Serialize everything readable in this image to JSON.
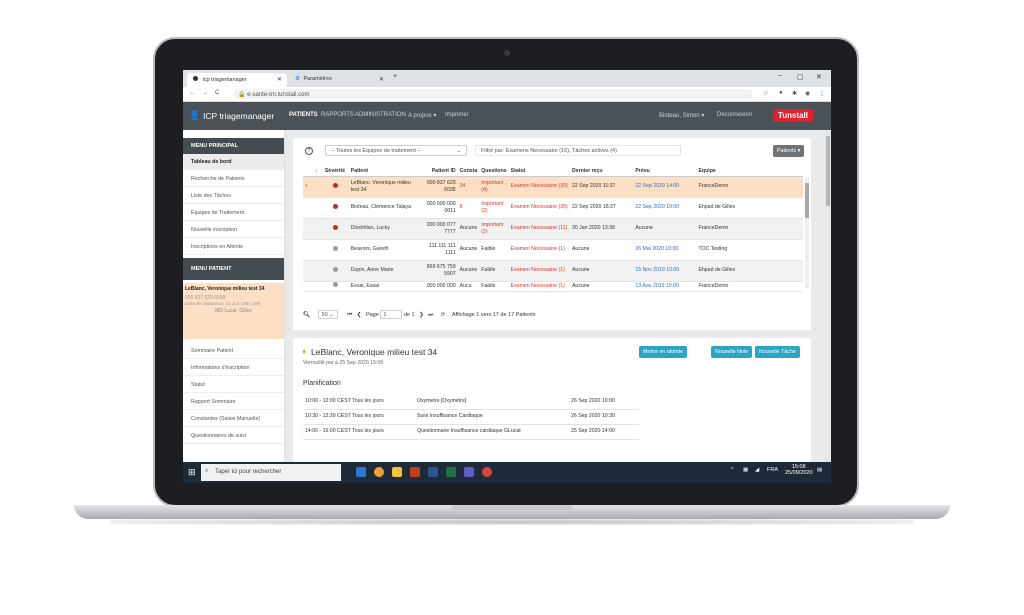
{
  "browser": {
    "tabs": [
      {
        "label": "icp triagemanager"
      },
      {
        "label": "Paramètres"
      }
    ],
    "new_tab": "+",
    "url": "e-sante-tm.tunstall.com",
    "window_controls": [
      "−",
      "▢",
      "✕"
    ]
  },
  "app": {
    "name": "ICP triagemanager",
    "nav": [
      "PATIENTS",
      "RAPPORTS",
      "ADMINISTRATION",
      "A propos ▾",
      "Imprimer"
    ],
    "user": "Bioteau, Simon ▾",
    "logout": "Déconnexion",
    "brand": "Tunstall"
  },
  "sidebar": {
    "menu_principal": "MENU PRINCIPAL",
    "main_items": [
      "Tableau de bord",
      "Recherche de Patients",
      "Liste des Tâches",
      "Equipes de Traitement",
      "Nouvelle inscription",
      "Inscriptions en Attente"
    ],
    "menu_patient": "MENU PATIENT",
    "patient": {
      "name": "LeBlanc, Veronique milieu test 34",
      "id": "000 837 629 6038",
      "dob": "Date de naissance: 21 Jun 1951 (69)",
      "doctor": "MD Lucat, Gilles"
    },
    "patient_items": [
      "Sommaire Patient",
      "Informations d'inscription",
      "Statut",
      "Rapport Sommaire",
      "Constantes (Saisie Manuelle)",
      "Questionnaires de suivi"
    ]
  },
  "filter": {
    "help": "?",
    "teams_select": "-- Toutes les Equipes de traitement --",
    "filter_text": "Filtré par: Examens Necessaire (16), Tâches actives (4)",
    "patients_button": "Patients ▾"
  },
  "table": {
    "headers": [
      "",
      "↓",
      "Sévérité",
      "Patient",
      "Patient ID",
      "Consta",
      "Questions",
      "Statut",
      "Dernier reçu",
      "Prévu",
      "Equipe"
    ],
    "rows": [
      {
        "severity": "red",
        "patient": "LeBlanc, Veronique milieu test 34",
        "id": "000 837 629 6038",
        "consta": "34",
        "questions": "Important (4)",
        "statut": "Examen Necessaire (39)",
        "last": "22 Sep 2020 11:37",
        "planned": "22 Sep 2020 14:00",
        "team": "FranceDemo"
      },
      {
        "severity": "red",
        "patient": "Bioteau, Clémence Talaya",
        "id": "000 000 000 0011",
        "consta": "8",
        "questions": "Important (2)",
        "statut": "Examen Necessaire (30)",
        "last": "22 Sep 2020 18:37",
        "planned": "22 Sep 2020 10:00",
        "team": "Ehpad de Gilles"
      },
      {
        "severity": "red",
        "patient": "Dioclétian, Lucky",
        "id": "000 000 077 7777",
        "consta": "Aucune",
        "questions": "Important (2)",
        "statut": "Examen Necessaire (11)",
        "last": "30 Jan 2020 13:38",
        "planned": "Aucune",
        "team": "FranceDemo"
      },
      {
        "severity": "grey",
        "patient": "Beavors, Gareth",
        "id": "111 111 111 1111",
        "consta": "Aucune",
        "questions": "Faible",
        "statut": "Examen Necessaire (1)",
        "last": "Aucune",
        "planned": "26 Mai 2020 10:00",
        "team": "TOC Testing"
      },
      {
        "severity": "grey",
        "patient": "Dupin, Anne Marie",
        "id": "869 675 759 5907",
        "consta": "Aucune",
        "questions": "Faible",
        "statut": "Examen Necessaire (1)",
        "last": "Aucune",
        "planned": "15 Nov 2019 10:00",
        "team": "Ehpad de Gilles"
      },
      {
        "severity": "grey",
        "patient": "Essai, Essai",
        "id": "000 000 000",
        "consta": "Aucu",
        "questions": "Faible",
        "statut": "Examen Necessaire (1)",
        "last": "Aucune",
        "planned": "13 Aou 2019 10:00",
        "team": "FranceDemo"
      }
    ]
  },
  "pager": {
    "per_page": "50",
    "page_label": "Page",
    "page_value": "1",
    "of": "de 1",
    "summary": "Affichage 1 vers 17 de 17 Patients"
  },
  "detail": {
    "title": "LeBlanc, Veronique milieu test 34",
    "locked": "Verrouillé par à 25 Sep 2020 15:08",
    "buttons": [
      "Mettre en attente",
      "Nouvelle Note",
      "Nouvelle Tâche"
    ],
    "plan_title": "Planification",
    "plan_rows": [
      {
        "time": "10:00 - 12:00 CEST Tous les jours",
        "task": "Oxymetre [Oxymètre]",
        "date": "26 Sep 2020 10:00"
      },
      {
        "time": "10:30 - 12:30 CEST Tous les jours",
        "task": "Suivi Insuffisance Cardiaque",
        "date": "26 Sep 2020 10:30"
      },
      {
        "time": "14:00 - 16:00 CEST Tous les jours",
        "task": "Questionnaire Insuffisance cardiaque GLucat",
        "date": "25 Sep 2020 14:00"
      }
    ]
  },
  "taskbar": {
    "search": "Taper ici pour rechercher",
    "lang": "FRA",
    "time": "15:08",
    "date": "25/09/2020"
  },
  "colors": {
    "accent": "#2ba5c6",
    "brand": "#e4202e",
    "header": "#4a5157",
    "selected_row": "#fde0c3",
    "alert": "#d9342b"
  }
}
